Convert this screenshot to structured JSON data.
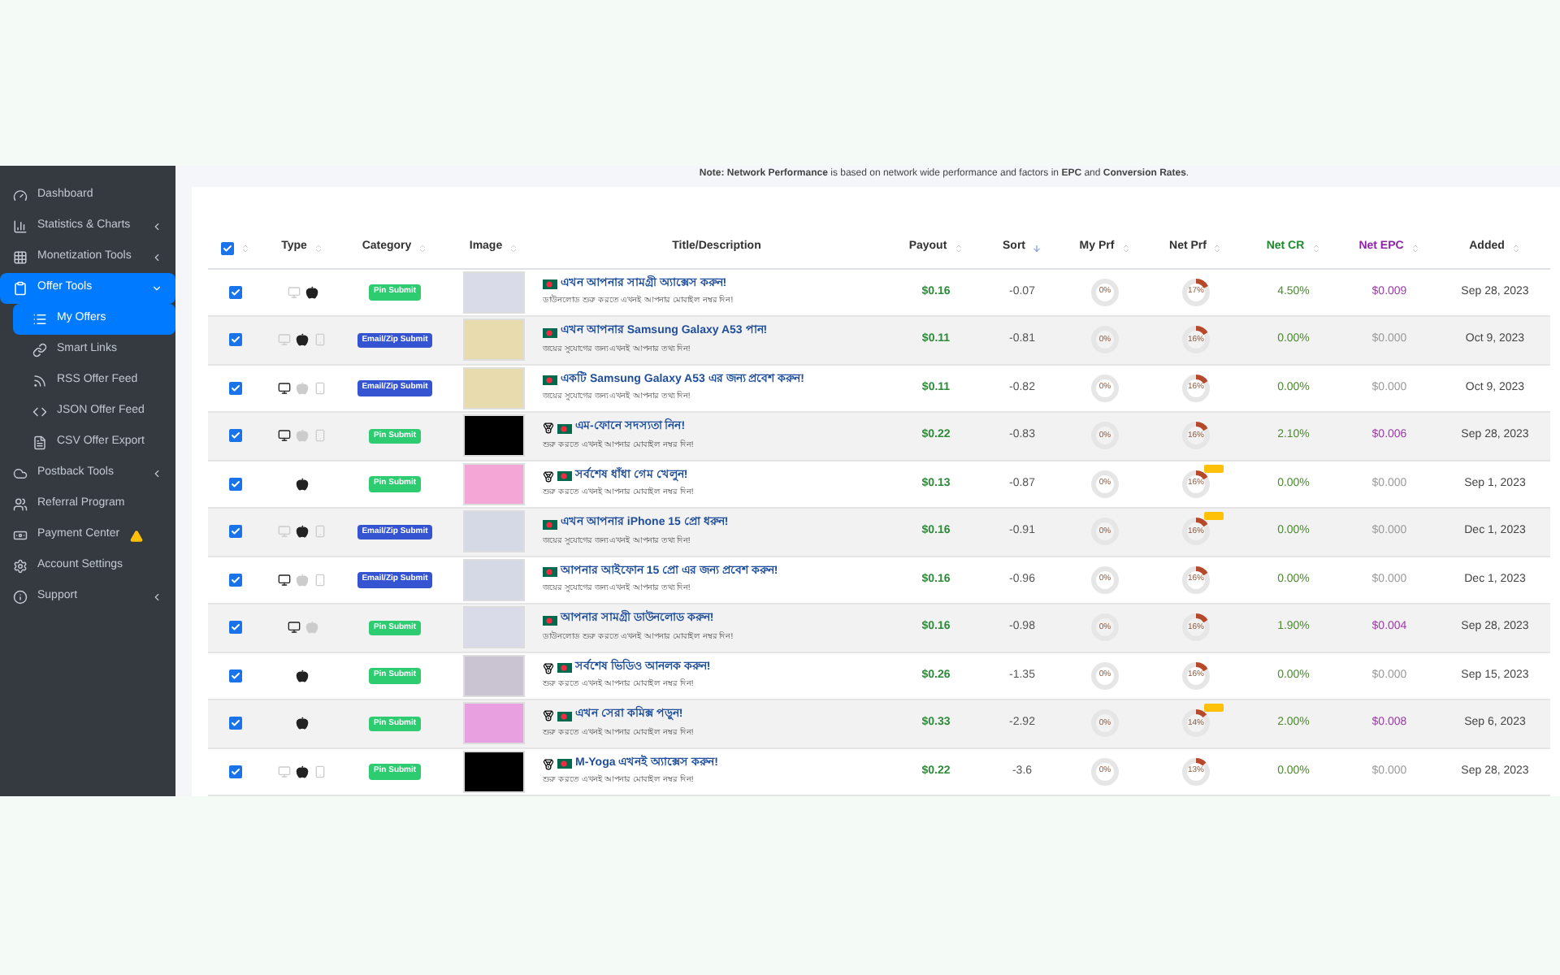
{
  "sidebar": {
    "items": [
      {
        "label": "Dashboard",
        "selected": false,
        "expandable": false
      },
      {
        "label": "Statistics & Charts",
        "selected": false,
        "expandable": true,
        "expanded": false
      },
      {
        "label": "Monetization Tools",
        "selected": false,
        "expandable": true,
        "expanded": false
      },
      {
        "label": "Offer Tools",
        "selected": true,
        "expandable": true,
        "expanded": true,
        "children": [
          {
            "label": "My Offers",
            "selected": true
          },
          {
            "label": "Smart Links",
            "selected": false
          },
          {
            "label": "RSS Offer Feed",
            "selected": false
          },
          {
            "label": "JSON Offer Feed",
            "selected": false
          },
          {
            "label": "CSV Offer Export",
            "selected": false
          }
        ]
      },
      {
        "label": "Postback Tools",
        "selected": false,
        "expandable": true,
        "expanded": false
      },
      {
        "label": "Referral Program",
        "selected": false,
        "expandable": false
      },
      {
        "label": "Payment Center",
        "selected": false,
        "expandable": false,
        "warning": true
      },
      {
        "label": "Account Settings",
        "selected": false,
        "expandable": false
      },
      {
        "label": "Support",
        "selected": false,
        "expandable": true,
        "expanded": false
      }
    ]
  },
  "note": "**Note: Network Performance** is based on network wide performance and factors in **EPC** and **Conversion Rates**.",
  "table": {
    "columns": [
      {
        "kind": "check",
        "checked": true,
        "sorted": false
      },
      {
        "label": "Type",
        "kind": "plain",
        "sorted": false
      },
      {
        "label": "Category",
        "kind": "plain",
        "sorted": false
      },
      {
        "label": "Image",
        "kind": "plain",
        "sorted": false
      },
      {
        "label": "Title/Description",
        "kind": "plain"
      },
      {
        "label": "Payout",
        "kind": "plain",
        "sorted": false
      },
      {
        "label": "Sort",
        "kind": "plain",
        "sorted": true
      },
      {
        "label": "My Prf",
        "kind": "plain",
        "sorted": false
      },
      {
        "label": "Net Prf",
        "kind": "plain",
        "sorted": false
      },
      {
        "label": "Net CR",
        "kind": "green",
        "sorted": false
      },
      {
        "label": "Net EPC",
        "kind": "purple",
        "sorted": false
      },
      {
        "label": "Added",
        "kind": "plain",
        "sorted": false
      }
    ],
    "rows": [
      {
        "checked": true,
        "types": [
          {
            "kind": "desktop",
            "active": false
          },
          {
            "kind": "apple",
            "active": true
          }
        ],
        "category": {
          "label": "Pin Submit",
          "kind": "pin"
        },
        "medal": false,
        "title": "এখন আপনার সামগ্রী অ্যাক্সেস করুন!",
        "description": "ডাউনলোড শুরু করতে এখনই আপনার মোবাইল নম্বর দিন!",
        "payout": "$0.16",
        "sort": "-0.07",
        "my_prf": "0%",
        "net_prf": {
          "reading": "17%",
          "level": 0.17,
          "badge": false
        },
        "net_cr": "4.50%",
        "net_epc": {
          "value": "$0.009",
          "muted": false
        },
        "added": "Sep 28, 2023"
      },
      {
        "checked": true,
        "types": [
          {
            "kind": "desktop",
            "active": false
          },
          {
            "kind": "apple",
            "active": true
          },
          {
            "kind": "android",
            "active": false
          }
        ],
        "category": {
          "label": "Email/Zip Submit",
          "kind": "email"
        },
        "medal": false,
        "title": "এখন আপনার Samsung Galaxy A53 পান!",
        "description": "জয়ের সুযোগের জন্য এখনই আপনার তথ্য দিন!",
        "payout": "$0.11",
        "sort": "-0.81",
        "my_prf": "0%",
        "net_prf": {
          "reading": "16%",
          "level": 0.16,
          "badge": false
        },
        "net_cr": "0.00%",
        "net_epc": {
          "value": "$0.000",
          "muted": true
        },
        "added": "Oct 9, 2023"
      },
      {
        "checked": true,
        "types": [
          {
            "kind": "desktop",
            "active": true
          },
          {
            "kind": "apple",
            "active": false
          },
          {
            "kind": "android",
            "active": false
          }
        ],
        "category": {
          "label": "Email/Zip Submit",
          "kind": "email"
        },
        "medal": false,
        "title": "একটি Samsung Galaxy A53 এর জন্য প্রবেশ করুন!",
        "description": "জয়ের সুযোগের জন্য এখনই আপনার তথ্য দিন!",
        "payout": "$0.11",
        "sort": "-0.82",
        "my_prf": "0%",
        "net_prf": {
          "reading": "16%",
          "level": 0.16,
          "badge": false
        },
        "net_cr": "0.00%",
        "net_epc": {
          "value": "$0.000",
          "muted": true
        },
        "added": "Oct 9, 2023"
      },
      {
        "checked": true,
        "types": [
          {
            "kind": "desktop",
            "active": true
          },
          {
            "kind": "apple",
            "active": false
          },
          {
            "kind": "android",
            "active": false
          }
        ],
        "category": {
          "label": "Pin Submit",
          "kind": "pin"
        },
        "medal": true,
        "title": "এম-ফোনে সদস্যতা নিন!",
        "description": "শুরু করতে এখনই আপনার মোবাইল নম্বর দিন!",
        "payout": "$0.22",
        "sort": "-0.83",
        "my_prf": "0%",
        "net_prf": {
          "reading": "16%",
          "level": 0.16,
          "badge": false
        },
        "net_cr": "2.10%",
        "net_epc": {
          "value": "$0.006",
          "muted": false
        },
        "added": "Sep 28, 2023"
      },
      {
        "checked": true,
        "types": [
          {
            "kind": "apple",
            "active": true
          }
        ],
        "category": {
          "label": "Pin Submit",
          "kind": "pin"
        },
        "medal": true,
        "title": "সর্বশেষ ধাঁধা গেম খেলুন!",
        "description": "শুরু করতে এখনই আপনার মোবাইল নম্বর দিন!",
        "payout": "$0.13",
        "sort": "-0.87",
        "my_prf": "0%",
        "net_prf": {
          "reading": "16%",
          "level": 0.16,
          "badge": true
        },
        "net_cr": "0.00%",
        "net_epc": {
          "value": "$0.000",
          "muted": true
        },
        "added": "Sep 1, 2023"
      },
      {
        "checked": true,
        "types": [
          {
            "kind": "desktop",
            "active": false
          },
          {
            "kind": "apple",
            "active": true
          },
          {
            "kind": "android",
            "active": false
          }
        ],
        "category": {
          "label": "Email/Zip Submit",
          "kind": "email"
        },
        "medal": false,
        "title": "এখন আপনার iPhone 15 প্রো ধরুন!",
        "description": "জয়ের সুযোগের জন্য এখনই আপনার তথ্য দিন!",
        "payout": "$0.16",
        "sort": "-0.91",
        "my_prf": "0%",
        "net_prf": {
          "reading": "16%",
          "level": 0.16,
          "badge": true
        },
        "net_cr": "0.00%",
        "net_epc": {
          "value": "$0.000",
          "muted": true
        },
        "added": "Dec 1, 2023"
      },
      {
        "checked": true,
        "types": [
          {
            "kind": "desktop",
            "active": true
          },
          {
            "kind": "apple",
            "active": false
          },
          {
            "kind": "android",
            "active": false
          }
        ],
        "category": {
          "label": "Email/Zip Submit",
          "kind": "email"
        },
        "medal": false,
        "title": "আপনার আইফোন 15 প্রো এর জন্য প্রবেশ করুন!",
        "description": "জয়ের সুযোগের জন্য এখনই আপনার তথ্য দিন!",
        "payout": "$0.16",
        "sort": "-0.96",
        "my_prf": "0%",
        "net_prf": {
          "reading": "16%",
          "level": 0.16,
          "badge": false
        },
        "net_cr": "0.00%",
        "net_epc": {
          "value": "$0.000",
          "muted": true
        },
        "added": "Dec 1, 2023"
      },
      {
        "checked": true,
        "types": [
          {
            "kind": "desktop",
            "active": true
          },
          {
            "kind": "apple",
            "active": false
          }
        ],
        "category": {
          "label": "Pin Submit",
          "kind": "pin"
        },
        "medal": false,
        "title": "আপনার সামগ্রী ডাউনলোড করুন!",
        "description": "ডাউনলোড শুরু করতে এখনই আপনার মোবাইল নম্বর দিন!",
        "payout": "$0.16",
        "sort": "-0.98",
        "my_prf": "0%",
        "net_prf": {
          "reading": "16%",
          "level": 0.16,
          "badge": false
        },
        "net_cr": "1.90%",
        "net_epc": {
          "value": "$0.004",
          "muted": false
        },
        "added": "Sep 28, 2023"
      },
      {
        "checked": true,
        "types": [
          {
            "kind": "apple",
            "active": true
          }
        ],
        "category": {
          "label": "Pin Submit",
          "kind": "pin"
        },
        "medal": true,
        "title": "সর্বশেষ ভিডিও আনলক করুন!",
        "description": "শুরু করতে এখনই আপনার মোবাইল নম্বর দিন!",
        "payout": "$0.26",
        "sort": "-1.35",
        "my_prf": "0%",
        "net_prf": {
          "reading": "16%",
          "level": 0.16,
          "badge": false
        },
        "net_cr": "0.00%",
        "net_epc": {
          "value": "$0.000",
          "muted": true
        },
        "added": "Sep 15, 2023"
      },
      {
        "checked": true,
        "types": [
          {
            "kind": "apple",
            "active": true
          }
        ],
        "category": {
          "label": "Pin Submit",
          "kind": "pin"
        },
        "medal": true,
        "title": "এখন সেরা কমিক্স পড়ুন!",
        "description": "শুরু করতে এখনই আপনার মোবাইল নম্বর দিন!",
        "payout": "$0.33",
        "sort": "-2.92",
        "my_prf": "0%",
        "net_prf": {
          "reading": "14%",
          "level": 0.14,
          "badge": true
        },
        "net_cr": "2.00%",
        "net_epc": {
          "value": "$0.008",
          "muted": false
        },
        "added": "Sep 6, 2023"
      },
      {
        "checked": true,
        "types": [
          {
            "kind": "desktop",
            "active": false
          },
          {
            "kind": "apple",
            "active": true
          },
          {
            "kind": "android",
            "active": false
          }
        ],
        "category": {
          "label": "Pin Submit",
          "kind": "pin"
        },
        "medal": true,
        "title": "M-Yoga এখনই অ্যাক্সেস করুন!",
        "description": "শুরু করতে এখনই আপনার মোবাইল নম্বর দিন!",
        "payout": "$0.22",
        "sort": "-3.6",
        "my_prf": "0%",
        "net_prf": {
          "reading": "13%",
          "level": 0.13,
          "badge": false
        },
        "net_cr": "0.00%",
        "net_epc": {
          "value": "$0.000",
          "muted": true
        },
        "added": "Sep 28, 2023"
      }
    ]
  }
}
